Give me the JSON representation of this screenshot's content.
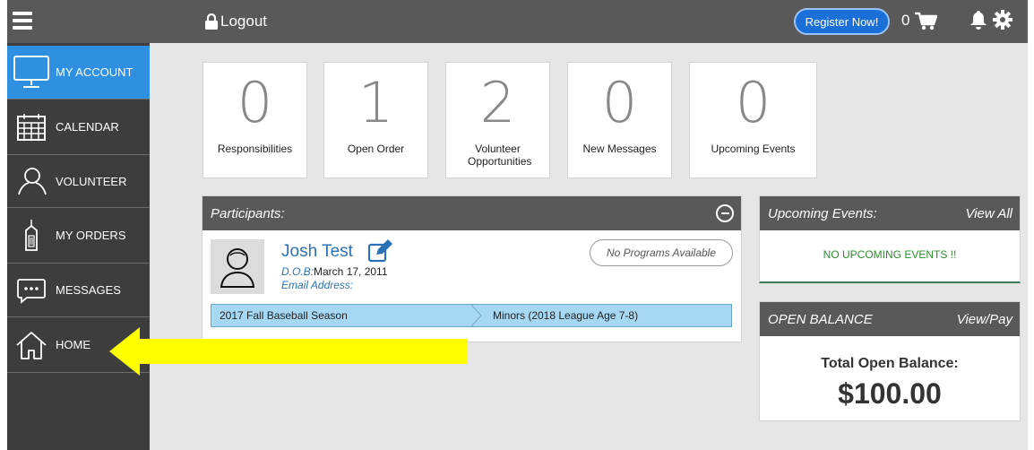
{
  "topbar": {
    "logout_label": "Logout",
    "register_label": "Register Now!",
    "cart_count": "0",
    "icons": [
      "menu-icon",
      "lock-icon",
      "cart-icon",
      "bell-icon",
      "gear-icon"
    ]
  },
  "sidebar": {
    "items": [
      {
        "label": "MY ACCOUNT",
        "icon": "monitor-icon",
        "active": true
      },
      {
        "label": "CALENDAR",
        "icon": "calendar-icon"
      },
      {
        "label": "VOLUNTEER",
        "icon": "person-icon"
      },
      {
        "label": "MY ORDERS",
        "icon": "tag-icon"
      },
      {
        "label": "MESSAGES",
        "icon": "chat-icon"
      },
      {
        "label": "HOME",
        "icon": "home-icon"
      }
    ]
  },
  "stats": [
    {
      "value": "0",
      "label": "Responsibilities"
    },
    {
      "value": "1",
      "label": "Open Order"
    },
    {
      "value": "2",
      "label": "Volunteer Opportunities"
    },
    {
      "value": "0",
      "label": "New Messages"
    },
    {
      "value": "0",
      "label": "Upcoming Events"
    }
  ],
  "participants": {
    "title": "Participants:",
    "name": "Josh Test",
    "dob_label": "D.O.B:",
    "dob_value": "March 17, 2011",
    "email_label": "Email Address:",
    "no_programs": "No Programs Available",
    "season": "2017 Fall Baseball Season",
    "division": "Minors (2018 League Age 7-8)"
  },
  "upcoming": {
    "title": "Upcoming Events:",
    "link": "View All",
    "empty_text": "NO UPCOMING EVENTS !!"
  },
  "balance": {
    "title": "OPEN BALANCE",
    "link": "View/Pay",
    "label": "Total Open Balance:",
    "amount": "$100.00"
  },
  "colors": {
    "topbar": "#595959",
    "sidebar": "#3d3d3d",
    "active_nav": "#2f8fe0",
    "register_button": "#1a6fd8",
    "link_blue": "#2a72b5",
    "season_bar": "#a7d8f3",
    "annotation_arrow": "#ffff00"
  }
}
